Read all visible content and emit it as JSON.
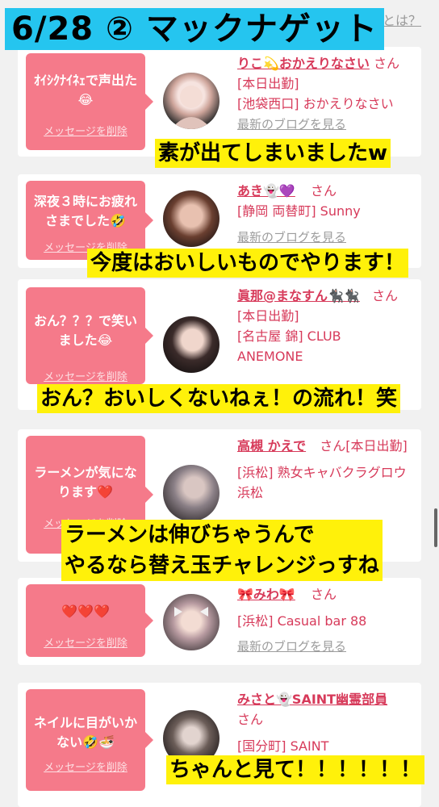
{
  "page": {
    "title": "6/28 ② マックナゲット",
    "top_link": "とは？"
  },
  "cards": [
    {
      "message": "ｵｲｼｸﾅｲﾈｪで声出た😂",
      "delete_label": "メッセージを削除",
      "name": "りこ💫おかえりなさい",
      "san": "さん",
      "lines": [
        "[本日出勤]",
        "[池袋西口] おかえりなさい"
      ],
      "blog": "最新のブログを見る",
      "caption": [
        "素が出てしまいましたw"
      ]
    },
    {
      "message": "深夜３時にお疲れさまでした🤣",
      "delete_label": "メッセージを削除",
      "name": "あき👻💜",
      "san": "さん",
      "lines": [
        "[静岡 両替町] Sunny"
      ],
      "blog": "最新のブログを見る",
      "caption": [
        "今度はおいしいものでやります！"
      ]
    },
    {
      "message": "おん？？？で笑いました😂",
      "delete_label": "メッセージを削除",
      "name": "眞那@まなすん🐈‍⬛🐈‍⬛",
      "san": "さん",
      "lines": [
        "[本日出勤]",
        "[名古屋 錦] CLUB",
        "ANEMONE"
      ],
      "blog": "",
      "caption": [
        "おん？おいしくないねぇ！の流れ！笑"
      ]
    },
    {
      "message": "ラーメンが気になります❤️",
      "delete_label": "メッセージを削除",
      "name": "高槻 かえで",
      "san": "さん",
      "lines": [
        "[本日出勤]",
        "[浜松] 熟女キャバクラグロウ 浜松"
      ],
      "blog": "",
      "caption": [
        "ラーメンは伸びちゃうんで",
        "やるなら替え玉チャレンジっすね"
      ]
    },
    {
      "message": "❤️❤️❤️",
      "delete_label": "メッセージを削除",
      "name": "🎀みわ🎀",
      "san": "さん",
      "lines": [
        "[浜松] Casual bar 88"
      ],
      "blog": "最新のブログを見る",
      "caption": []
    },
    {
      "message": "ネイルに目がいかない🤣🍜",
      "delete_label": "メッセージを削除",
      "name": "みさと👻SAINT幽霊部員",
      "san": "さん",
      "lines": [
        "[国分町] SAINT"
      ],
      "blog": "",
      "caption": [
        "ちゃんと見て！！！！！！"
      ]
    }
  ],
  "colors": {
    "accent_pink": "#f57a8a",
    "name_red": "#d73a5a",
    "caption_yellow": "#fff10a",
    "banner_cyan": "#25c5ef"
  }
}
